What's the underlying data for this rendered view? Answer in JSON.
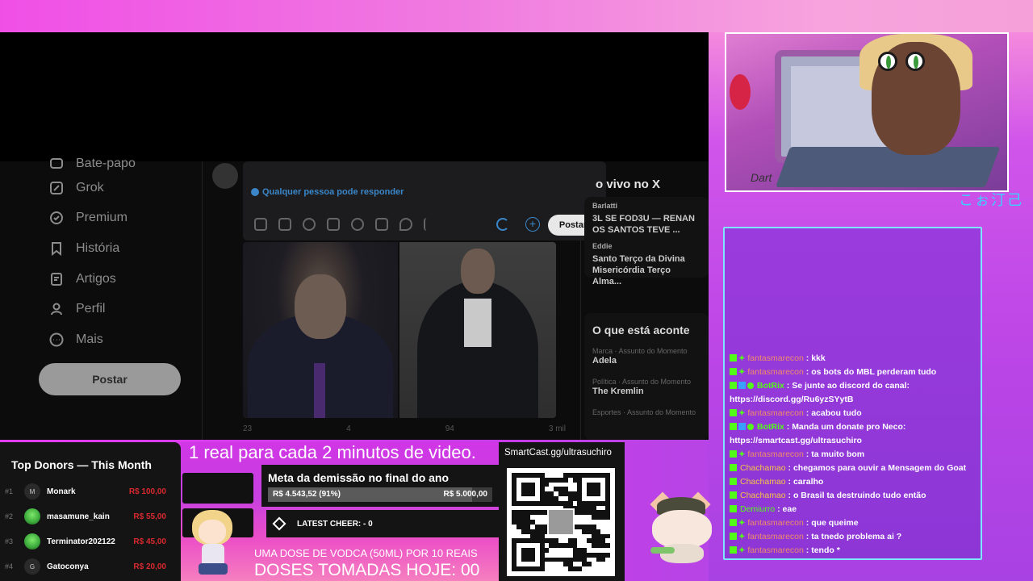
{
  "screen": {
    "nav": {
      "items": [
        "Bate-papo",
        "Grok",
        "Premium",
        "História",
        "Artigos",
        "Perfil",
        "Mais"
      ],
      "post_button": "Postar"
    },
    "composer": {
      "reply_hint": "Qualquer pessoa pode responder",
      "post_button": "Postar"
    },
    "feed_actions": [
      "23",
      "4",
      "94",
      "3 mil"
    ],
    "sidebar": {
      "live_title": "o vivo no X",
      "live_user": "Barlatti",
      "live_text": "3L SE FOD3U — RENAN\nOS SANTOS TEVE ...",
      "eddie_user": "Eddie",
      "eddie_text": "Santo Terço da Divina\nMisericórdia  Terço  Alma...",
      "trending_title": "O que está aconte",
      "trend1_meta": "Marca · Assunto do Momento",
      "trend1": "Adela",
      "trend2_meta": "Política · Assunto do Momento",
      "trend2": "The Kremlin",
      "trend3_meta": "Esportes · Assunto do Momento"
    }
  },
  "webcam": {
    "signature": "Dart",
    "tag": "こぉ汀己"
  },
  "chat": [
    {
      "user": "fantasmarecon",
      "color": "#f08c6a",
      "text": "kkk",
      "badges": "kick"
    },
    {
      "user": "fantasmarecon",
      "color": "#f08c6a",
      "text": "os bots do MBL perderam tudo",
      "badges": "kick"
    },
    {
      "user": "BotRix",
      "color": "#53fc18",
      "text": "Se junte ao discord do canal: https://discord.gg/Ru6yzSYytB",
      "badges": "bot"
    },
    {
      "user": "fantasmarecon",
      "color": "#f08c6a",
      "text": "acabou tudo",
      "badges": "kick"
    },
    {
      "user": "BotRix",
      "color": "#53fc18",
      "text": "Manda um donate pro Neco: https://smartcast.gg/ultrasuchiro",
      "badges": "bot"
    },
    {
      "user": "fantasmarecon",
      "color": "#f08c6a",
      "text": "ta muito bom",
      "badges": "kick"
    },
    {
      "user": "Chachamao",
      "color": "#f6c445",
      "text": "chegamos para ouvir a Mensagem do Goat",
      "badges": "single"
    },
    {
      "user": "Chachamao",
      "color": "#f6c445",
      "text": "caralho",
      "badges": "single"
    },
    {
      "user": "Chachamao",
      "color": "#f6c445",
      "text": "o Brasil ta destruindo tudo então",
      "badges": "single"
    },
    {
      "user": "Demiurro",
      "color": "#53fc18",
      "text": "eae",
      "badges": "single"
    },
    {
      "user": "fantasmarecon",
      "color": "#f08c6a",
      "text": "que queime",
      "badges": "kick"
    },
    {
      "user": "fantasmarecon",
      "color": "#f08c6a",
      "text": "ta tnedo problema ai ?",
      "badges": "kick"
    },
    {
      "user": "fantasmarecon",
      "color": "#f08c6a",
      "text": "tendo *",
      "badges": "kick"
    }
  ],
  "donors": {
    "title": "Top Donors — This Month",
    "list": [
      {
        "rank": "#1",
        "initial": "M",
        "name": "Monark",
        "amount": "R$ 100,00"
      },
      {
        "rank": "#2",
        "initial": "",
        "name": "masamune_kain",
        "amount": "R$ 55,00"
      },
      {
        "rank": "#3",
        "initial": "",
        "name": "Terminator202122",
        "amount": "R$ 45,00"
      },
      {
        "rank": "#4",
        "initial": "G",
        "name": "Gatoconya",
        "amount": "R$ 20,00"
      }
    ]
  },
  "promo": {
    "headline": "1 real para cada 2 minutos de video.",
    "goal_title": "Meta da demissão no final do ano",
    "goal_current": "R$ 4.543,52 (91%)",
    "goal_target": "R$ 5.000,00",
    "goal_fraction": 0.91,
    "cheer": "LATEST CHEER:  - 0",
    "vodka": "UMA DOSE DE VODCA (50ML) POR 10 REAIS",
    "doses": "DOSES TOMADAS HOJE: 00"
  },
  "qr": {
    "title": "SmartCast.gg/ultrasuchiro"
  },
  "colors": {
    "accent_pink": "#e23df0",
    "chat_border": "#7fe6ff",
    "kick_green": "#53fc18",
    "donor_red": "#d8292f"
  }
}
